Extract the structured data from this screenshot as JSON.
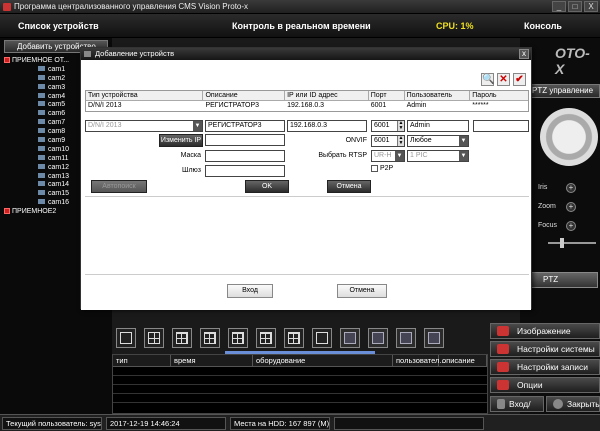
{
  "window": {
    "title": "Программа централизованного управления CMS Vision Proto-x",
    "min_label": "_",
    "max_label": "□",
    "close_label": "X"
  },
  "header": {
    "devices": "Список устройств",
    "realtime": "Контроль в реальном времени",
    "cpu": "CPU: 1%",
    "console": "Консоль"
  },
  "sidebar": {
    "add_device": "Добавить устройство",
    "group1": "ПРИЕМНОЕ ОТ...",
    "cameras": [
      "cam1",
      "cam2",
      "cam3",
      "cam4",
      "cam5",
      "cam6",
      "cam7",
      "cam8",
      "cam9",
      "cam10",
      "cam11",
      "cam12",
      "cam13",
      "cam14",
      "cam15",
      "cam16"
    ],
    "group2": "ПРИЕМНОЕ2"
  },
  "right": {
    "brand": "OTO-X",
    "ptz_control": "PTZ управление",
    "iris": "Iris",
    "zoom": "Zoom",
    "focus": "Focus",
    "plus": "+",
    "ptz": "PTZ",
    "menu": [
      "Изображение",
      "Настройки системы",
      "Настройки записи",
      "Опции"
    ],
    "login": "Вход/Вых",
    "lock": "Закрыть"
  },
  "events": {
    "columns": [
      "тип",
      "время",
      "оборудование",
      "пользовател...",
      "описание"
    ]
  },
  "status": {
    "user": "Текущий пользователь: system",
    "datetime": "2017-12-19 14:46:24",
    "hdd": "Места на HDD: 167 897 (М)"
  },
  "dialog": {
    "title": "Добавление устройств",
    "close": "x",
    "toolbar": [
      "🔍",
      "✕",
      "✔"
    ],
    "table": {
      "columns": [
        "Тип устройства",
        "Описание",
        "IP или ID адрес",
        "Порт",
        "Пользователь",
        "Пароль"
      ],
      "rows": [
        [
          "D/N/I 2013",
          "РЕГИСТРАТОР3",
          "192.168.0.3",
          "6001",
          "Admin",
          "******"
        ]
      ]
    },
    "form": {
      "type": "D/N/I 2013",
      "description": "РЕГИСТРАТОР3",
      "ip": "192.168.0.3",
      "port": "6001",
      "user": "Admin",
      "password": "",
      "change_ip": "Изменить IP",
      "mask_label": "Маска",
      "gateway_label": "Шлюз",
      "onvif_label": "ONVIF",
      "onvif_port": "6001",
      "onvif_any": "Любое",
      "rtsp_label": "Выбрать RTSP",
      "rtsp_value": "UR-H",
      "rtsp_pic": "1 PIC",
      "p2p_label": "P2P",
      "autosearch": "Автопоиск",
      "ok": "OK",
      "cancel": "Отмена"
    },
    "footer": {
      "enter": "Вход",
      "cancel": "Отмена"
    }
  }
}
